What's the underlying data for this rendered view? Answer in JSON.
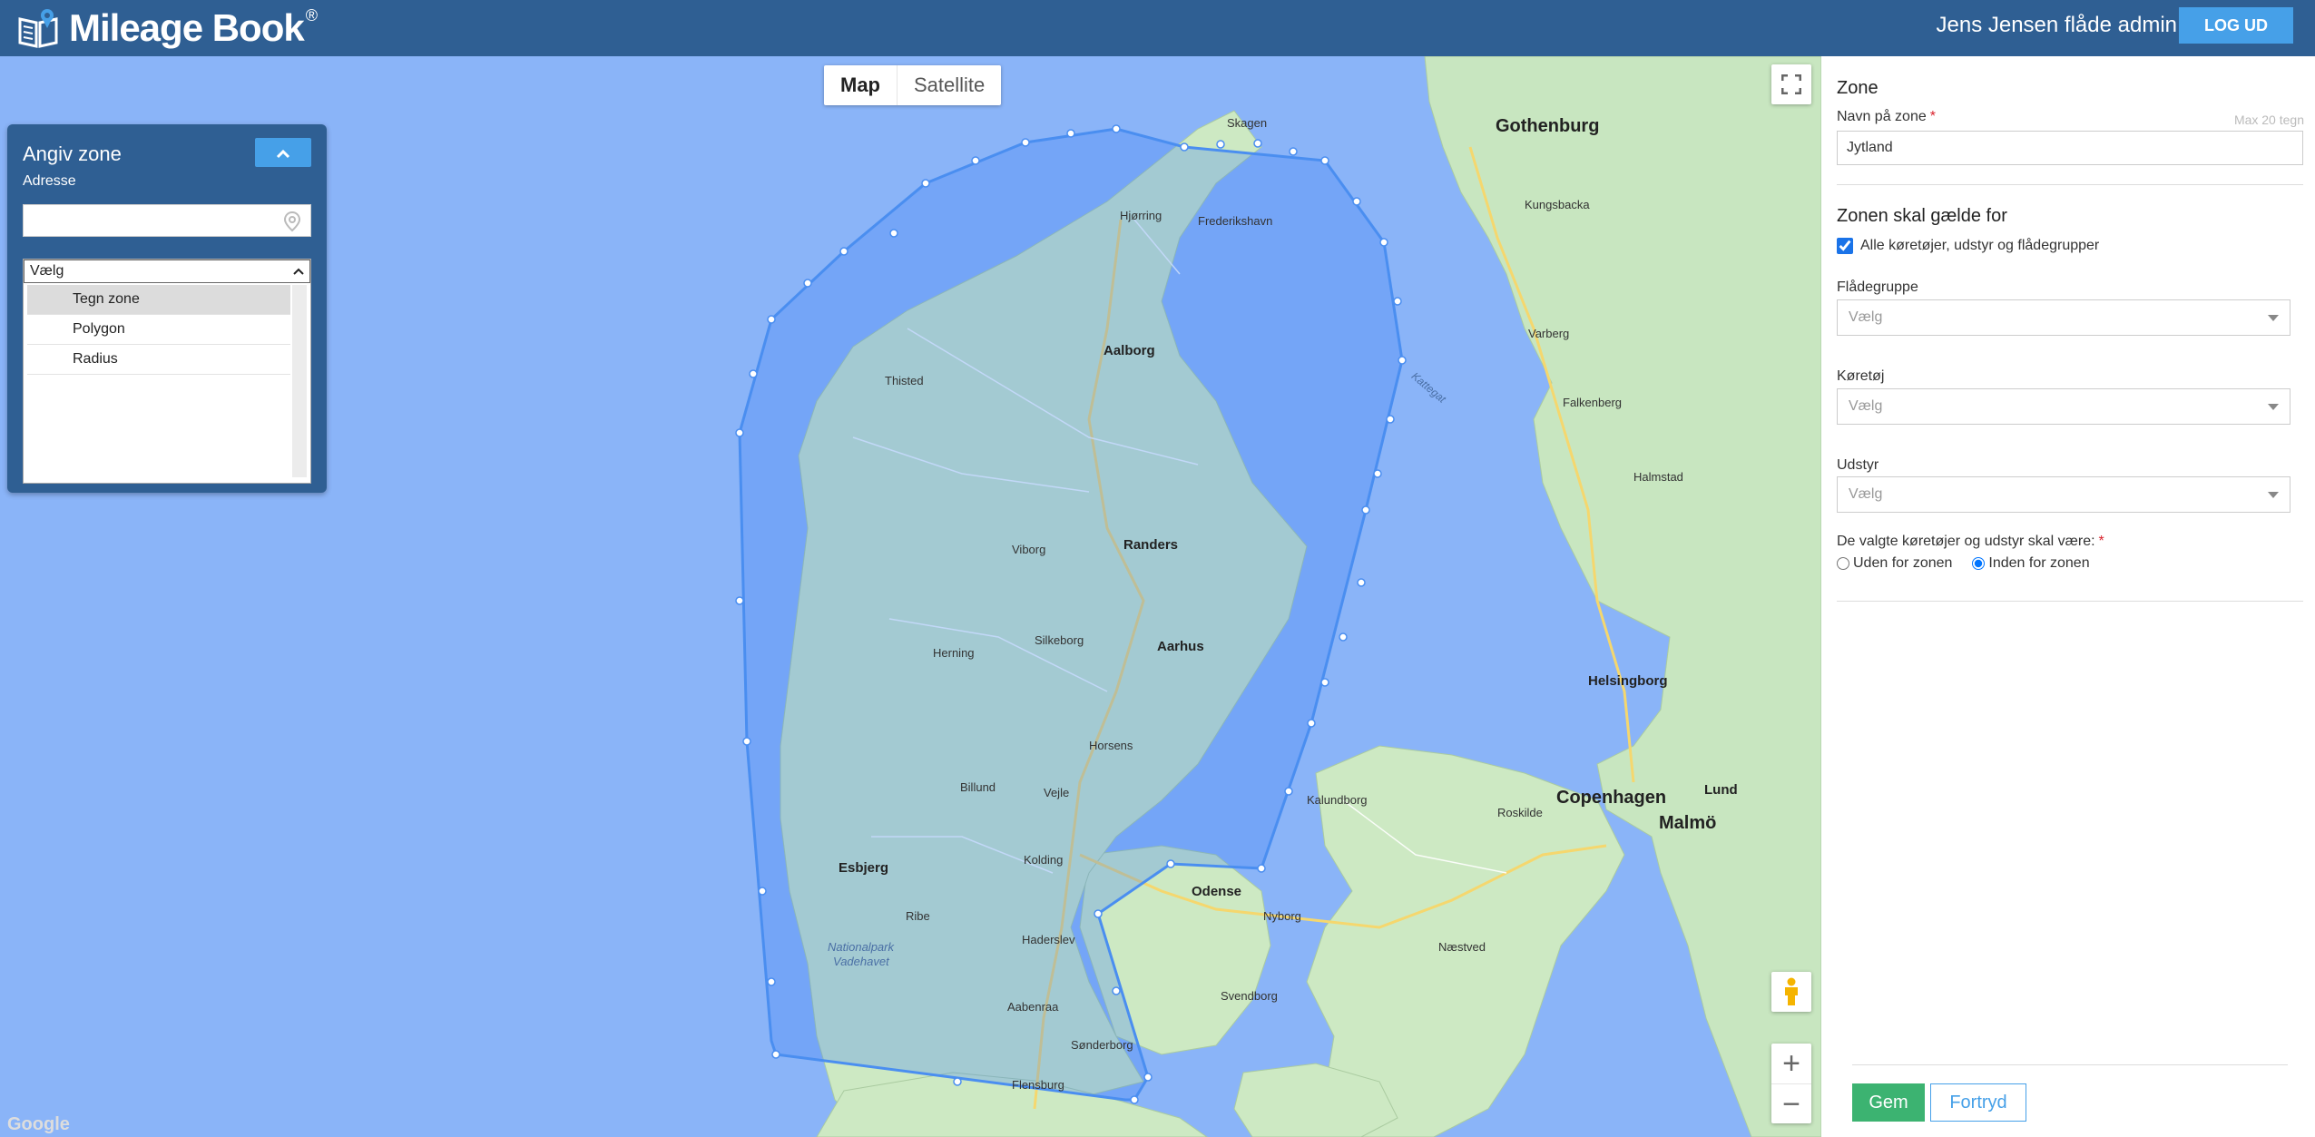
{
  "header": {
    "app_name": "Mileage Book",
    "registered_mark": "®",
    "user_name": "Jens Jensen flåde admin",
    "logout_label": "LOG UD",
    "brand_color": "#2f5f93",
    "accent_color": "#46a0e8"
  },
  "map": {
    "type_map_label": "Map",
    "type_satellite_label": "Satellite",
    "selected_type": "Map",
    "zoom_in_label": "+",
    "zoom_out_label": "−",
    "fullscreen_icon": "fullscreen-icon",
    "pegman_icon": "pegman-icon",
    "google_label": "Google",
    "labels": {
      "gothenburg": "Gothenburg",
      "copenhagen": "Copenhagen",
      "malmo": "Malmö",
      "helsingborg": "Helsingborg",
      "lund": "Lund",
      "aalborg": "Aalborg",
      "aarhus": "Aarhus",
      "randers": "Randers",
      "esbjerg": "Esbjerg",
      "odense": "Odense",
      "kolding": "Kolding",
      "vejle": "Vejle",
      "horsens": "Horsens",
      "herning": "Herning",
      "viborg": "Viborg",
      "skagen": "Skagen",
      "frederikshavn": "Frederikshavn",
      "hjorring": "Hjørring",
      "thisted": "Thisted",
      "silkeborg": "Silkeborg",
      "billund": "Billund",
      "ribe": "Ribe",
      "haderslev": "Haderslev",
      "aabenraa": "Aabenraa",
      "sonderborg": "Sønderborg",
      "flensburg": "Flensburg",
      "kungsbacka": "Kungsbacka",
      "varberg": "Varberg",
      "falkenberg": "Falkenberg",
      "halmstad": "Halmstad",
      "kalundborg": "Kalundborg",
      "roskilde": "Roskilde",
      "naestved": "Næstved",
      "svendborg": "Svendborg",
      "nyborg": "Nyborg",
      "kattegat": "Kattegat",
      "nationalpark": "Nationalpark",
      "vadehavet": "Vadehavet"
    }
  },
  "zone_panel": {
    "title": "Angiv zone",
    "collapse_icon": "chevron-up-icon",
    "address_label": "Adresse",
    "address_value": "",
    "address_placeholder": "",
    "select_value": "Vælg",
    "options": [
      "Tegn zone",
      "Polygon",
      "Radius"
    ]
  },
  "form": {
    "heading": "Zone",
    "name_label": "Navn på zone",
    "required_mark": "*",
    "max_hint": "Max 20 tegn",
    "name_value": "Jytland",
    "applies_heading": "Zonen skal gælde for",
    "all_checkbox_label": "Alle køretøjer, udstyr og flådegrupper",
    "all_checked": true,
    "fleet_group_label": "Flådegruppe",
    "fleet_group_value": "Vælg",
    "vehicle_label": "Køretøj",
    "vehicle_value": "Vælg",
    "equipment_label": "Udstyr",
    "equipment_value": "Vælg",
    "position_label": "De valgte køretøjer og udstyr skal være:",
    "outside_label": "Uden for zonen",
    "inside_label": "Inden for zonen",
    "selected_position": "inside",
    "save_label": "Gem",
    "cancel_label": "Fortryd",
    "save_color": "#3cb371"
  }
}
